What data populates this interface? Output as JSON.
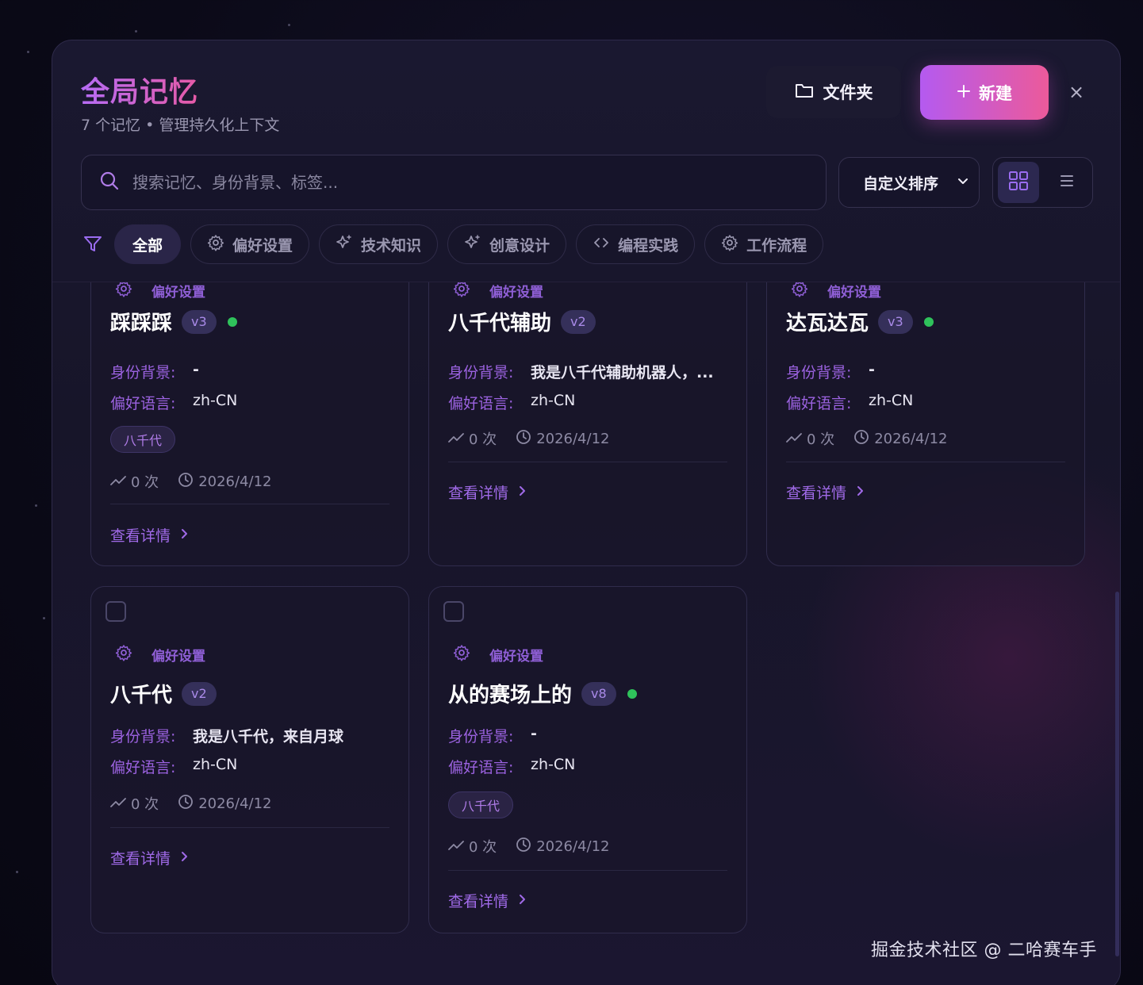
{
  "header": {
    "title": "全局记忆",
    "subtitle": "7 个记忆 • 管理持久化上下文",
    "folder_label": "文件夹",
    "new_label": "新建",
    "close_label": "×"
  },
  "search": {
    "placeholder": "搜索记忆、身份背景、标签..."
  },
  "sort": {
    "selected": "自定义排序"
  },
  "filters": [
    {
      "label": "全部",
      "icon": "none",
      "active": true
    },
    {
      "label": "偏好设置",
      "icon": "gear-icon"
    },
    {
      "label": "技术知识",
      "icon": "sparkle-icon"
    },
    {
      "label": "创意设计",
      "icon": "sparkle-icon"
    },
    {
      "label": "编程实践",
      "icon": "code-icon"
    },
    {
      "label": "工作流程",
      "icon": "gear-icon"
    }
  ],
  "field_labels": {
    "identity": "身份背景:",
    "language": "偏好语言:"
  },
  "detail_label": "查看详情",
  "cards": [
    {
      "category": "偏好设置",
      "name": "踩踩踩",
      "version": "v3",
      "active": true,
      "identity": "-",
      "language": "zh-CN",
      "tag": "八千代",
      "uses": "0 次",
      "date": "2026/4/12"
    },
    {
      "category": "偏好设置",
      "name": "八千代辅助",
      "version": "v2",
      "active": false,
      "identity": "我是八千代辅助机器人，...",
      "language": "zh-CN",
      "uses": "0 次",
      "date": "2026/4/12"
    },
    {
      "category": "偏好设置",
      "name": "达瓦达瓦",
      "version": "v3",
      "active": true,
      "identity": "-",
      "language": "zh-CN",
      "uses": "0 次",
      "date": "2026/4/12"
    },
    {
      "category": "偏好设置",
      "name": "八千代",
      "version": "v2",
      "active": false,
      "identity": "我是八千代，来自月球",
      "language": "zh-CN",
      "uses": "0 次",
      "date": "2026/4/12"
    },
    {
      "category": "偏好设置",
      "name": "从的赛场上的",
      "version": "v8",
      "active": true,
      "identity": "-",
      "language": "zh-CN",
      "tag": "八千代",
      "uses": "0 次",
      "date": "2026/4/12"
    }
  ],
  "colors": {
    "accent": "#b45af0",
    "accent2": "#ec5a9a",
    "active_dot": "#2fc25b"
  },
  "watermark": "掘金技术社区 @ 二哈赛车手"
}
